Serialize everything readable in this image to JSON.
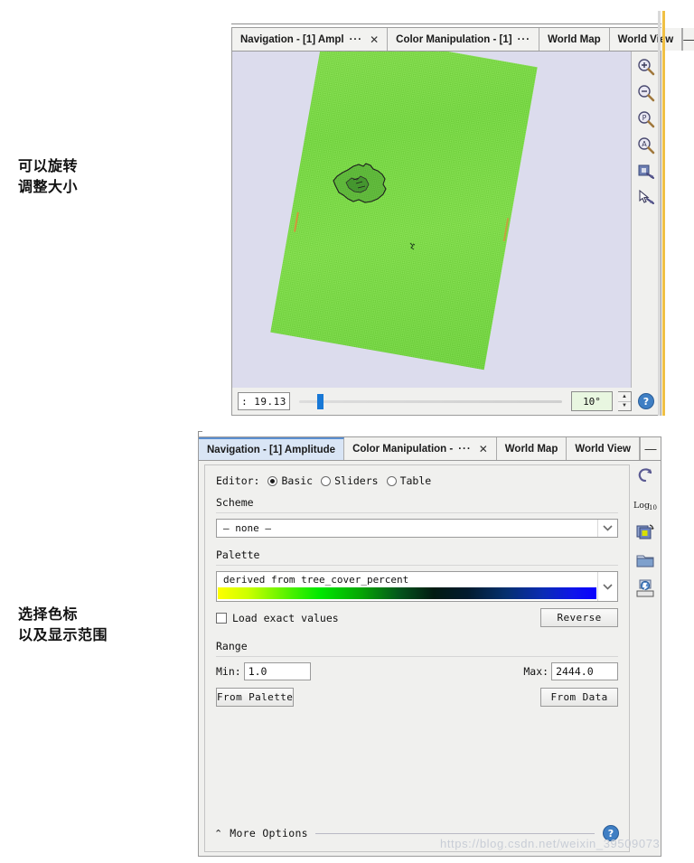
{
  "annotations": {
    "rotate": "可以旋转\n调整大小",
    "palette": "选择色标\n以及显示范围"
  },
  "image_panel": {
    "tabs": [
      {
        "label": "Navigation - [1] Ampl",
        "ellipsis": "···",
        "closable": true,
        "active": false
      },
      {
        "label": "Color Manipulation - [1]",
        "ellipsis": "···",
        "closable": false,
        "active": false
      },
      {
        "label": "World Map",
        "ellipsis": "",
        "closable": false,
        "active": false
      },
      {
        "label": "World View",
        "ellipsis": "",
        "closable": false,
        "active": false
      }
    ],
    "minimize_label": "—",
    "toolbar": [
      {
        "name": "zoom-in-icon",
        "glyph": "+"
      },
      {
        "name": "zoom-out-icon",
        "glyph": "−"
      },
      {
        "name": "zoom-pixel-icon",
        "glyph": "P"
      },
      {
        "name": "zoom-all-icon",
        "glyph": "A"
      },
      {
        "name": "sync-view-icon",
        "glyph": "▣"
      },
      {
        "name": "select-cursor-icon",
        "glyph": "↖"
      }
    ],
    "footer": {
      "ratio_value": ": 19.13",
      "angle_value": "10°",
      "spin_up": "▲",
      "spin_down": "▼",
      "help_glyph": "?"
    },
    "canvas": {
      "background_color": "#dcdced",
      "raster_color": "#7ade3f",
      "rotation_degrees": 10
    }
  },
  "color_panel": {
    "tabs": [
      {
        "label": "Navigation - [1] Amplitude",
        "ellipsis": "",
        "closable": false,
        "active": true
      },
      {
        "label": "Color Manipulation -",
        "ellipsis": "···",
        "closable": true,
        "active": false
      },
      {
        "label": "World Map",
        "ellipsis": "",
        "closable": false,
        "active": false
      },
      {
        "label": "World View",
        "ellipsis": "",
        "closable": false,
        "active": false
      }
    ],
    "minimize_label": "—",
    "editor": {
      "label": "Editor:",
      "options": [
        {
          "label": "Basic",
          "selected": true
        },
        {
          "label": "Sliders",
          "selected": false
        },
        {
          "label": "Table",
          "selected": false
        }
      ]
    },
    "scheme": {
      "title": "Scheme",
      "value": "— none —",
      "arrow": "⌄"
    },
    "palette": {
      "title": "Palette",
      "value": "derived from tree_cover_percent",
      "arrow": "⌄",
      "gradient_stops": [
        "#ffff00",
        "#00e800",
        "#04551c",
        "#021b2e",
        "#0a2bb5",
        "#0a00ff"
      ],
      "load_exact_values_label": "Load exact values",
      "load_exact_values_checked": false,
      "reverse_label": "Reverse"
    },
    "range": {
      "title": "Range",
      "min_label": "Min:",
      "min_value": "1.0",
      "max_label": "Max:",
      "max_value": "2444.0",
      "from_palette_label": "From Palette",
      "from_data_label": "From Data"
    },
    "more_options_label": "More Options",
    "more_options_chevron": "⌃",
    "side_tools": [
      {
        "name": "reset-icon",
        "glyph": "↺"
      },
      {
        "name": "log10-icon",
        "glyph": "Log₁₀"
      },
      {
        "name": "apply-multiple-icon",
        "glyph": "▤"
      },
      {
        "name": "open-folder-icon",
        "glyph": "📁"
      },
      {
        "name": "save-icon",
        "glyph": "💾"
      }
    ],
    "help_glyph": "?"
  },
  "watermark": "https://blog.csdn.net/weixin_39509073"
}
